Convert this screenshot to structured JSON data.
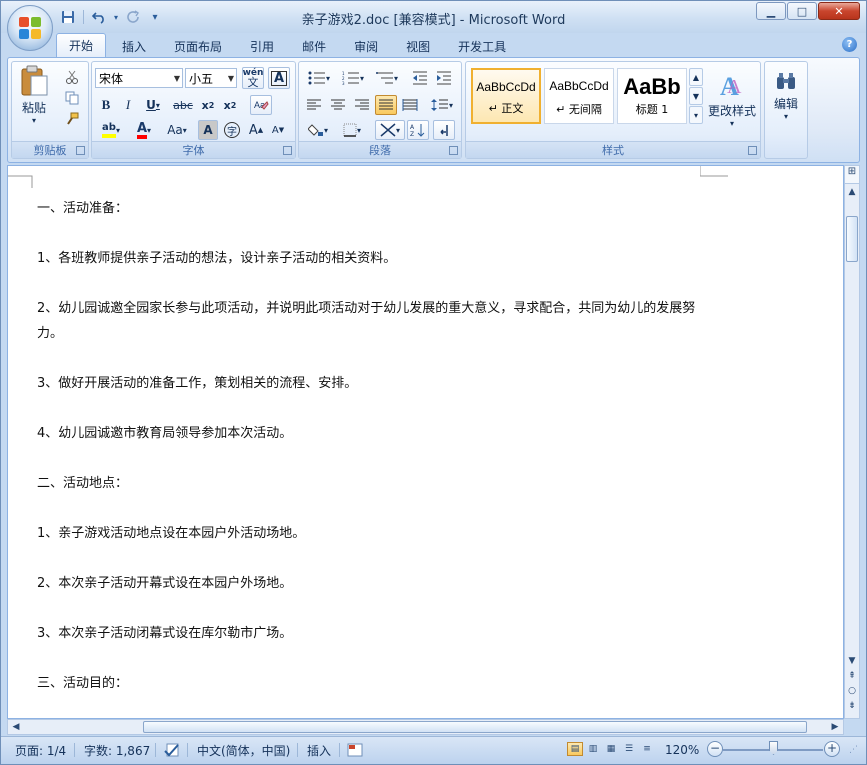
{
  "window": {
    "title": "亲子游戏2.doc [兼容模式] - Microsoft Word",
    "controls": {
      "minimize": "▁",
      "maximize": "□",
      "close": "✕"
    }
  },
  "quick_access": {
    "save_icon": "save-icon",
    "undo_icon": "undo-icon",
    "redo_icon": "redo-icon",
    "customize": "▾"
  },
  "tabs": [
    "开始",
    "插入",
    "页面布局",
    "引用",
    "邮件",
    "审阅",
    "视图",
    "开发工具"
  ],
  "active_tab": "开始",
  "ribbon": {
    "clipboard": {
      "label": "剪贴板",
      "paste_label": "粘贴"
    },
    "font": {
      "label": "字体",
      "font_name": "宋体",
      "font_size": "小五",
      "wen_label": "wén\n文"
    },
    "paragraph": {
      "label": "段落"
    },
    "styles": {
      "label": "样式",
      "items": [
        {
          "sample": "AaBbCcDd",
          "name": "↵ 正文",
          "selected": true
        },
        {
          "sample": "AaBbCcDd",
          "name": "↵ 无间隔",
          "selected": false
        },
        {
          "sample": "AaBb",
          "name": "标题 1",
          "selected": false
        }
      ],
      "change_styles_label": "更改样式"
    },
    "editing": {
      "label": "编辑"
    }
  },
  "document": {
    "paragraphs": [
      "一、活动准备：",
      "1、各班教师提供亲子活动的想法，设计亲子活动的相关资料。",
      "2、幼儿园诚邀全园家长参与此项活动，并说明此项活动对于幼儿发展的重大意义，寻求配合，共同为幼儿的发展努力。",
      "3、做好开展活动的准备工作，策划相关的流程、安排。",
      "4、幼儿园诚邀市教育局领导参加本次活动。",
      "二、活动地点：",
      "1、亲子游戏活动地点设在本园户外活动场地。",
      "2、本次亲子活动开幕式设在本园户外场地。",
      "3、本次亲子活动闭幕式设在库尔勒市广场。",
      "三、活动目的："
    ]
  },
  "statusbar": {
    "page": "页面: 1/4",
    "words": "字数: 1,867",
    "language": "中文(简体，中国)",
    "mode": "插入",
    "zoom": "120%",
    "zoom_level_percent": 120
  },
  "colors": {
    "accent": "#2a5d9b",
    "ribbon_bg": "#dfe9f7",
    "selected_style": "#fde7b2"
  }
}
